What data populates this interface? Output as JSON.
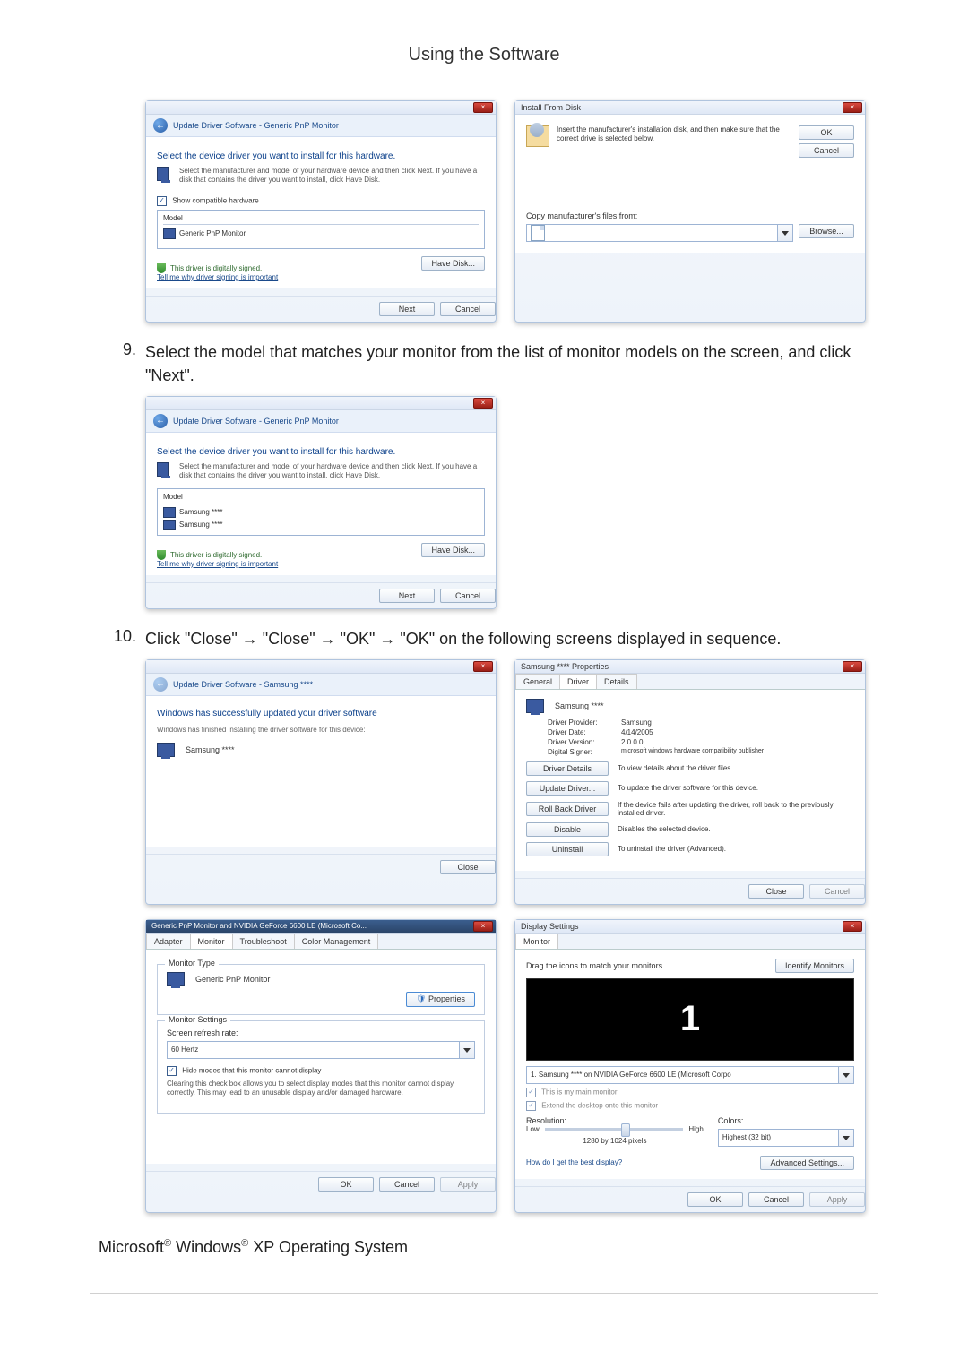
{
  "page_title": "Using the Software",
  "steps": {
    "s9": {
      "num": "9.",
      "text": "Select the model that matches your monitor from the list of monitor models on the screen, and click \"Next\"."
    },
    "s10": {
      "num": "10.",
      "text": "Click \"Close\" → \"Close\" → \"OK\" → \"OK\" on the following screens displayed in sequence."
    }
  },
  "dlg_update1": {
    "breadcrumb": "Update Driver Software - Generic PnP Monitor",
    "heading": "Select the device driver you want to install for this hardware.",
    "subtext": "Select the manufacturer and model of your hardware device and then click Next. If you have a disk that contains the driver you want to install, click Have Disk.",
    "show_compat": "Show compatible hardware",
    "list_header": "Model",
    "item1": "Generic PnP Monitor",
    "signed": "This driver is digitally signed.",
    "signed_link": "Tell me why driver signing is important",
    "have_disk": "Have Disk...",
    "next": "Next",
    "cancel": "Cancel"
  },
  "dlg_install": {
    "title": "Install From Disk",
    "text": "Insert the manufacturer's installation disk, and then make sure that the correct drive is selected below.",
    "ok": "OK",
    "cancel": "Cancel",
    "copy_label": "Copy manufacturer's files from:",
    "browse": "Browse..."
  },
  "dlg_update2": {
    "breadcrumb": "Update Driver Software - Generic PnP Monitor",
    "heading": "Select the device driver you want to install for this hardware.",
    "subtext": "Select the manufacturer and model of your hardware device and then click Next. If you have a disk that contains the driver you want to install, click Have Disk.",
    "list_header": "Model",
    "item1": "Samsung ****",
    "item2": "Samsung ****",
    "signed": "This driver is digitally signed.",
    "signed_link": "Tell me why driver signing is important",
    "have_disk": "Have Disk...",
    "next": "Next",
    "cancel": "Cancel"
  },
  "dlg_success": {
    "breadcrumb": "Update Driver Software - Samsung ****",
    "heading": "Windows has successfully updated your driver software",
    "subtext": "Windows has finished installing the driver software for this device:",
    "device": "Samsung ****",
    "close": "Close"
  },
  "dlg_props": {
    "title": "Samsung **** Properties",
    "tab_general": "General",
    "tab_driver": "Driver",
    "tab_details": "Details",
    "device": "Samsung ****",
    "provider_k": "Driver Provider:",
    "provider_v": "Samsung",
    "date_k": "Driver Date:",
    "date_v": "4/14/2005",
    "version_k": "Driver Version:",
    "version_v": "2.0.0.0",
    "signer_k": "Digital Signer:",
    "signer_v": "microsoft windows hardware compatibility publisher",
    "btn_details": "Driver Details",
    "desc_details": "To view details about the driver files.",
    "btn_update": "Update Driver...",
    "desc_update": "To update the driver software for this device.",
    "btn_rollback": "Roll Back Driver",
    "desc_rollback": "If the device fails after updating the driver, roll back to the previously installed driver.",
    "btn_disable": "Disable",
    "desc_disable": "Disables the selected device.",
    "btn_uninstall": "Uninstall",
    "desc_uninstall": "To uninstall the driver (Advanced).",
    "close": "Close",
    "cancel": "Cancel"
  },
  "dlg_monitor": {
    "title": "Generic PnP Monitor and NVIDIA GeForce 6600 LE (Microsoft Co...",
    "tab_adapter": "Adapter",
    "tab_monitor": "Monitor",
    "tab_trouble": "Troubleshoot",
    "tab_color": "Color Management",
    "group_type": "Monitor Type",
    "type_name": "Generic PnP Monitor",
    "btn_props": "Properties",
    "group_settings": "Monitor Settings",
    "refresh_label": "Screen refresh rate:",
    "refresh_value": "60 Hertz",
    "hide_modes": "Hide modes that this monitor cannot display",
    "hide_desc": "Clearing this check box allows you to select display modes that this monitor cannot display correctly. This may lead to an unusable display and/or damaged hardware.",
    "ok": "OK",
    "cancel": "Cancel",
    "apply": "Apply"
  },
  "dlg_display": {
    "title": "Display Settings",
    "tab_monitor": "Monitor",
    "drag_text": "Drag the icons to match your monitors.",
    "identify": "Identify Monitors",
    "monitor_num": "1",
    "combo": "1. Samsung **** on NVIDIA GeForce 6600 LE (Microsoft Corpo",
    "main_check": "This is my main monitor",
    "extend_check": "Extend the desktop onto this monitor",
    "res_label": "Resolution:",
    "low": "Low",
    "high": "High",
    "res_value": "1280 by 1024 pixels",
    "colors_label": "Colors:",
    "colors_value": "Highest (32 bit)",
    "help_link": "How do I get the best display?",
    "advanced": "Advanced Settings...",
    "ok": "OK",
    "cancel": "Cancel",
    "apply": "Apply"
  },
  "footnote": {
    "ms": "Microsoft",
    "win": "Windows",
    "rest": "XP Operating System",
    "reg": "®"
  }
}
